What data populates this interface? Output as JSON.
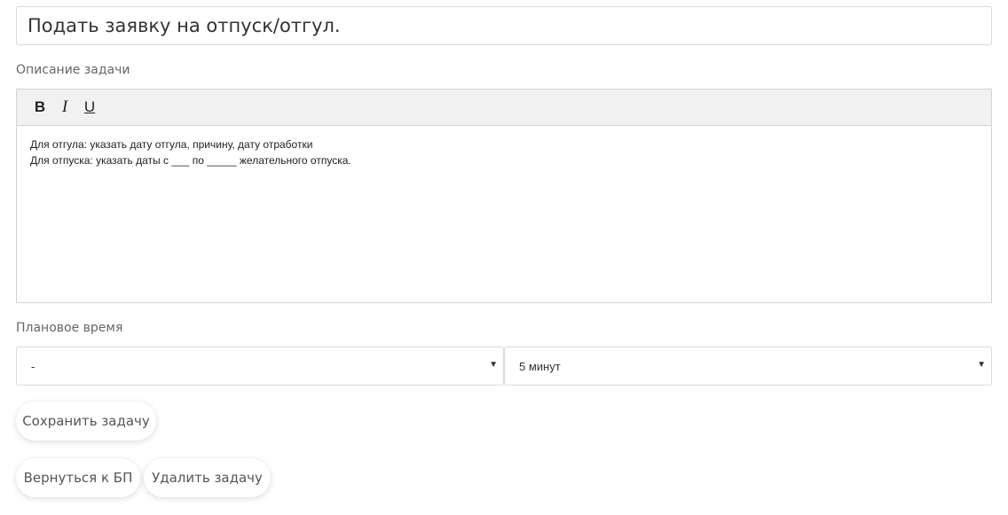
{
  "task": {
    "title_value": "Подать заявку на отпуск/отгул."
  },
  "description": {
    "label": "Описание задачи",
    "toolbar": {
      "bold_label": "B",
      "italic_label": "I",
      "underline_label": "U"
    },
    "lines": [
      "Для отгула: указать дату отгула, причину, дату отработки",
      "Для отпуска: указать даты с ___ по _____ желательного отпуска."
    ]
  },
  "planned_time": {
    "label": "Плановое время",
    "hours_value": "-",
    "minutes_value": "5 минут",
    "caret": "▼"
  },
  "buttons": {
    "save": "Сохранить задачу",
    "back": "Вернуться к БП",
    "delete": "Удалить задачу"
  }
}
